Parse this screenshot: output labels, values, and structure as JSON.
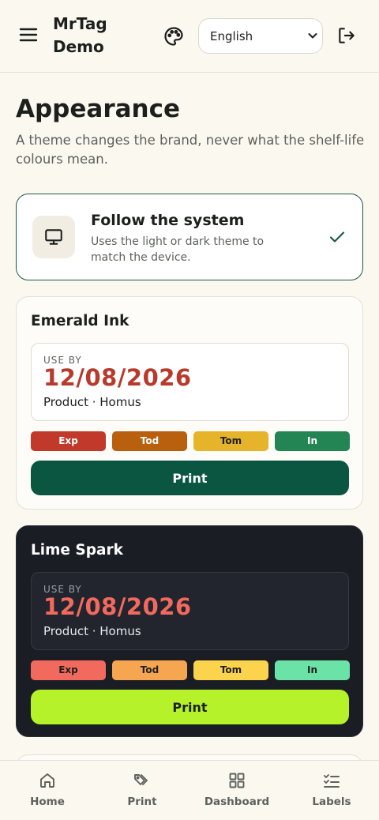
{
  "header": {
    "brand": "MrTag Demo",
    "language": {
      "selected": "English",
      "options": [
        "English"
      ]
    },
    "icons": {
      "menu": "menu-icon",
      "palette": "palette-icon",
      "logout": "logout-icon"
    }
  },
  "page": {
    "title": "Appearance",
    "subtitle": "A theme changes the brand, never what the shelf-life colours mean."
  },
  "system_option": {
    "title": "Follow the system",
    "description": "Uses the light or dark theme to match the device.",
    "selected": true,
    "icon": "monitor-icon"
  },
  "themes": [
    {
      "name": "Emerald Ink",
      "use_by_label": "USE BY",
      "date": "12/08/2026",
      "product": "Product · Homus",
      "chips": [
        "Exp",
        "Tod",
        "Tom",
        "In"
      ],
      "print_label": "Print",
      "colors": {
        "chips": [
          "#c0392b",
          "#b8600e",
          "#e6b42a",
          "#228553"
        ],
        "chip_text": [
          "#ffffff",
          "#ffffff",
          "#1c1f1c",
          "#ffffff"
        ],
        "print_bg": "#0a5640",
        "print_text": "#ffffff"
      }
    },
    {
      "name": "Lime Spark",
      "use_by_label": "USE BY",
      "date": "12/08/2026",
      "product": "Product · Homus",
      "chips": [
        "Exp",
        "Tod",
        "Tom",
        "In"
      ],
      "print_label": "Print",
      "colors": {
        "chips": [
          "#f26a5e",
          "#f6a550",
          "#fcd34d",
          "#6ce3a6"
        ],
        "chip_text": [
          "#1c1f1c",
          "#1c1f1c",
          "#1c1f1c",
          "#1c1f1c"
        ],
        "print_bg": "#b5f22a",
        "print_text": "#1c1f1c"
      }
    }
  ],
  "nav": {
    "items": [
      {
        "label": "Home",
        "icon": "home-icon"
      },
      {
        "label": "Print",
        "icon": "tags-icon"
      },
      {
        "label": "Dashboard",
        "icon": "grid-icon"
      },
      {
        "label": "Labels",
        "icon": "list-check-icon"
      }
    ]
  }
}
